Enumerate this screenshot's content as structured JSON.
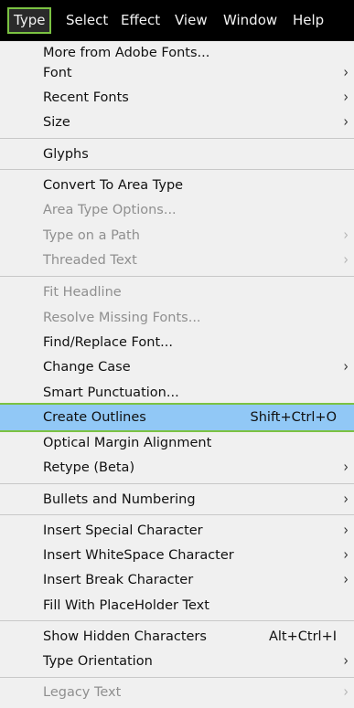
{
  "menubar": {
    "items": [
      "Type",
      "Select",
      "Effect",
      "View",
      "Window",
      "Help"
    ],
    "active_index": 0
  },
  "menu": {
    "items": [
      {
        "label": "More from Adobe Fonts...",
        "enabled": true
      },
      {
        "label": "Font",
        "enabled": true,
        "submenu": true
      },
      {
        "label": "Recent Fonts",
        "enabled": true,
        "submenu": true
      },
      {
        "label": "Size",
        "enabled": true,
        "submenu": true
      },
      {
        "label": "Glyphs",
        "enabled": true
      },
      {
        "label": "Convert To Area Type",
        "enabled": true
      },
      {
        "label": "Area Type Options...",
        "enabled": false
      },
      {
        "label": "Type on a Path",
        "enabled": false,
        "submenu": true
      },
      {
        "label": "Threaded Text",
        "enabled": false,
        "submenu": true
      },
      {
        "label": "Fit Headline",
        "enabled": false
      },
      {
        "label": "Resolve Missing Fonts...",
        "enabled": false
      },
      {
        "label": "Find/Replace Font...",
        "enabled": true
      },
      {
        "label": "Change Case",
        "enabled": true,
        "submenu": true
      },
      {
        "label": "Smart Punctuation...",
        "enabled": true
      },
      {
        "label": "Create Outlines",
        "enabled": true,
        "shortcut": "Shift+Ctrl+O",
        "highlighted": true
      },
      {
        "label": "Optical Margin Alignment",
        "enabled": true
      },
      {
        "label": "Retype (Beta)",
        "enabled": true,
        "submenu": true
      },
      {
        "label": "Bullets and Numbering",
        "enabled": true,
        "submenu": true
      },
      {
        "label": "Insert Special Character",
        "enabled": true,
        "submenu": true
      },
      {
        "label": "Insert WhiteSpace Character",
        "enabled": true,
        "submenu": true
      },
      {
        "label": "Insert Break Character",
        "enabled": true,
        "submenu": true
      },
      {
        "label": "Fill With PlaceHolder Text",
        "enabled": true
      },
      {
        "label": "Show Hidden Characters",
        "enabled": true,
        "shortcut": "Alt+Ctrl+I"
      },
      {
        "label": "Type Orientation",
        "enabled": true,
        "submenu": true
      },
      {
        "label": "Legacy Text",
        "enabled": false,
        "submenu": true
      }
    ],
    "chevron_glyph": "›"
  },
  "colors": {
    "highlight": "#91c8f6",
    "focus_outline": "#7bc242"
  }
}
